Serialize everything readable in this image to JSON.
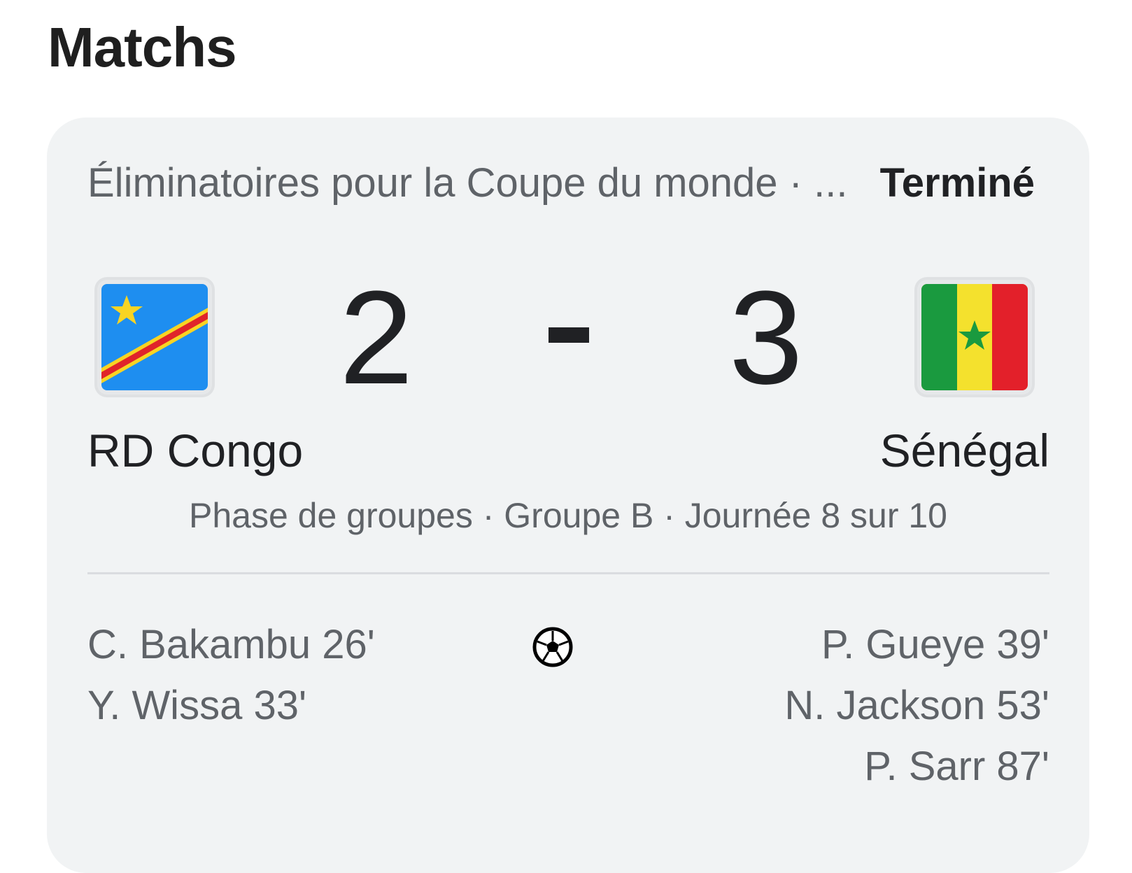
{
  "page_title": "Matchs",
  "match": {
    "competition": "Éliminatoires pour la Coupe du monde · ...",
    "status": "Terminé",
    "home": {
      "name": "RD Congo",
      "score": "2",
      "flag": "dr-congo-flag-icon",
      "scorers": [
        "C. Bakambu 26'",
        "Y. Wissa 33'"
      ]
    },
    "away": {
      "name": "Sénégal",
      "score": "3",
      "flag": "senegal-flag-icon",
      "scorers": [
        "P. Gueye 39'",
        "N. Jackson 53'",
        "P. Sarr 87'"
      ]
    },
    "stage": "Phase de groupes · Groupe B · Journée 8 sur 10",
    "goal_icon": "soccer-ball-icon"
  },
  "colors": {
    "card_bg": "#f1f3f4",
    "text_primary": "#202124",
    "text_secondary": "#5f6368",
    "drc_blue": "#1e8ef0",
    "drc_red": "#e0242a",
    "drc_yellow": "#f9d423",
    "sen_green": "#1a9a3f",
    "sen_yellow": "#f4e12d",
    "sen_red": "#e3202a"
  }
}
